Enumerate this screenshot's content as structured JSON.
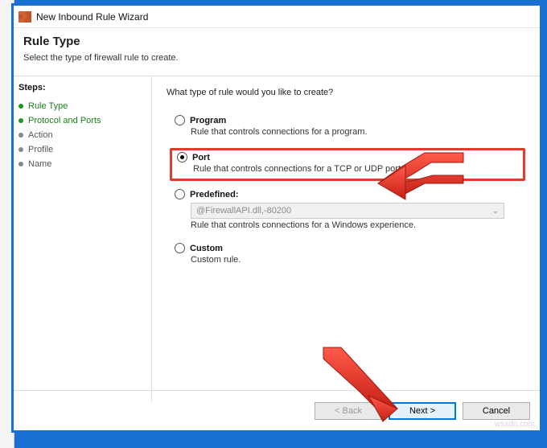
{
  "window": {
    "title": "New Inbound Rule Wizard"
  },
  "header": {
    "title": "Rule Type",
    "subtitle": "Select the type of firewall rule to create."
  },
  "steps": {
    "header": "Steps:",
    "items": [
      {
        "label": "Rule Type",
        "active": true
      },
      {
        "label": "Protocol and Ports",
        "active": true
      },
      {
        "label": "Action",
        "active": false
      },
      {
        "label": "Profile",
        "active": false
      },
      {
        "label": "Name",
        "active": false
      }
    ]
  },
  "content": {
    "prompt": "What type of rule would you like to create?",
    "options": [
      {
        "key": "program",
        "label": "Program",
        "desc": "Rule that controls connections for a program.",
        "selected": false,
        "highlight": false
      },
      {
        "key": "port",
        "label": "Port",
        "desc": "Rule that controls connections for a TCP or UDP port.",
        "selected": true,
        "highlight": true
      },
      {
        "key": "predefined",
        "label": "Predefined:",
        "desc": "Rule that controls connections for a Windows experience.",
        "selected": false,
        "highlight": false,
        "dropdown_value": "@FirewallAPI.dll,-80200"
      },
      {
        "key": "custom",
        "label": "Custom",
        "desc": "Custom rule.",
        "selected": false,
        "highlight": false
      }
    ]
  },
  "buttons": {
    "back": "< Back",
    "next": "Next >",
    "cancel": "Cancel"
  },
  "watermark": "wsxdn.com"
}
